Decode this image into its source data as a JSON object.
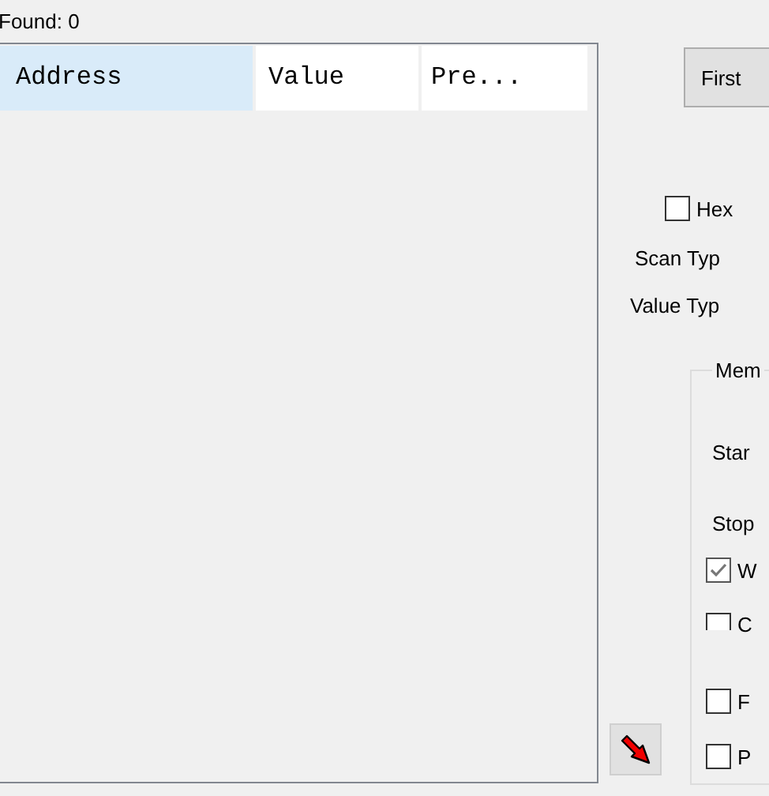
{
  "found_label": "Found: 0",
  "results_list": {
    "columns": [
      {
        "label": "Address",
        "selected": true
      },
      {
        "label": "Value",
        "selected": false
      },
      {
        "label": "Pre...",
        "selected": false
      }
    ]
  },
  "first_scan_button": "First",
  "hex_checkbox": {
    "label": "Hex",
    "checked": false
  },
  "scan_type_label": "Scan Typ",
  "value_type_label": "Value Typ",
  "memory_group": {
    "title": "Mem",
    "start_label": "Star",
    "stop_label": "Stop",
    "options": [
      {
        "label": "W",
        "checked": true
      },
      {
        "label": "C",
        "checked": false
      },
      {
        "label": "F",
        "checked": false
      },
      {
        "label": "P",
        "checked": false
      }
    ]
  }
}
